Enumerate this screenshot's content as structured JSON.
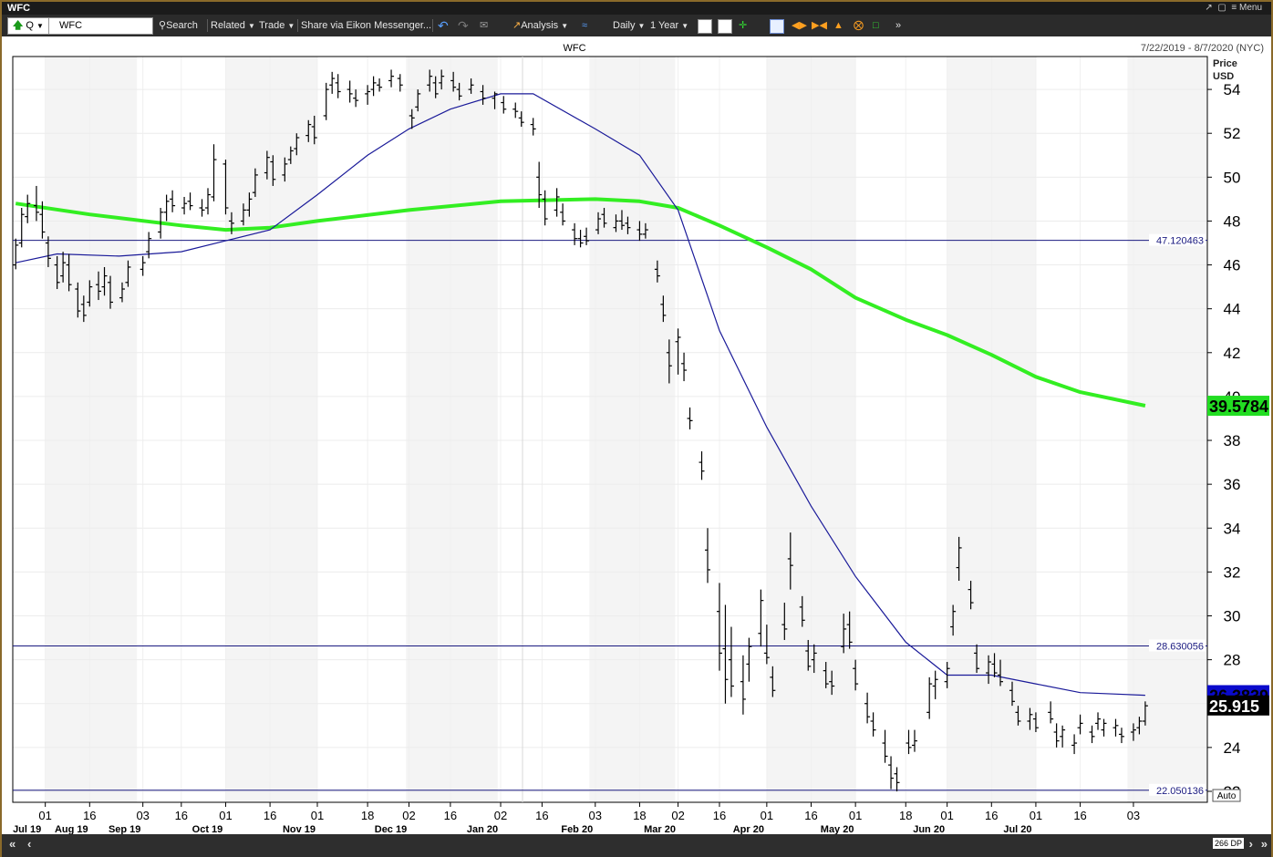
{
  "window": {
    "title": "WFC",
    "menu_label": "Menu"
  },
  "toolbar": {
    "ric_prefix": "Q",
    "ric_value": "WFC",
    "search_label": "Search",
    "related_label": "Related",
    "trade_label": "Trade",
    "share_label": "Share via Eikon Messenger...",
    "analysis_label": "Analysis",
    "interval_label": "Daily",
    "range_label": "1 Year"
  },
  "chart_header": {
    "symbol": "WFC",
    "date_range": "7/22/2019 - 8/7/2020 (NYC)",
    "price_axis_title_1": "Price",
    "price_axis_title_2": "USD"
  },
  "footer": {
    "datapoints": "266 DP",
    "auto_label": "Auto"
  },
  "colors": {
    "background": "#ffffff",
    "band_shade": "#f4f4f4",
    "ma200": "#33ee22",
    "ma50": "#1a1a99",
    "hline": "#1a1a80",
    "bars": "#000000",
    "last_price_bg": "#000000",
    "ma50_tag_bg": "#0a0acc",
    "ma200_tag_bg": "#22dd22"
  },
  "chart_data": {
    "type": "ohlc",
    "ylim": [
      21.5,
      55.5
    ],
    "y_ticks": [
      22,
      24,
      26,
      28,
      30,
      32,
      34,
      36,
      38,
      40,
      42,
      44,
      46,
      48,
      50,
      52,
      54
    ],
    "x_labels": [
      {
        "day": "01",
        "month": "Jul 19",
        "date": "2019-08-01"
      },
      {
        "day": "16",
        "month": "Aug 19",
        "date": "2019-08-16"
      },
      {
        "day": "03",
        "month": "Sep 19",
        "date": "2019-09-03"
      },
      {
        "day": "16",
        "date": "2019-09-16"
      },
      {
        "day": "01",
        "month": "Oct 19",
        "date": "2019-10-01"
      },
      {
        "day": "16",
        "date": "2019-10-16"
      },
      {
        "day": "01",
        "month": "Nov 19",
        "date": "2019-11-01"
      },
      {
        "day": "18",
        "date": "2019-11-18"
      },
      {
        "day": "02",
        "month": "Dec 19",
        "date": "2019-12-02"
      },
      {
        "day": "16",
        "date": "2019-12-16"
      },
      {
        "day": "02",
        "month": "Jan 20",
        "date": "2020-01-02"
      },
      {
        "day": "16",
        "date": "2020-01-16"
      },
      {
        "day": "03",
        "month": "Feb 20",
        "date": "2020-02-03"
      },
      {
        "day": "18",
        "date": "2020-02-18"
      },
      {
        "day": "02",
        "month": "Mar 20",
        "date": "2020-03-02"
      },
      {
        "day": "16",
        "date": "2020-03-16"
      },
      {
        "day": "01",
        "month": "Apr 20",
        "date": "2020-04-01"
      },
      {
        "day": "16",
        "date": "2020-04-16"
      },
      {
        "day": "01",
        "month": "May 20",
        "date": "2020-05-01"
      },
      {
        "day": "18",
        "date": "2020-05-18"
      },
      {
        "day": "01",
        "month": "Jun 20",
        "date": "2020-06-01"
      },
      {
        "day": "16",
        "date": "2020-06-16"
      },
      {
        "day": "01",
        "month": "Jul 20",
        "date": "2020-07-01"
      },
      {
        "day": "16",
        "date": "2020-07-16"
      },
      {
        "day": "03",
        "date": "2020-08-03"
      }
    ],
    "horizontal_lines": [
      {
        "label": "47.120463",
        "value": 47.120463
      },
      {
        "label": "28.630056",
        "value": 28.630056
      },
      {
        "label": "22.050136",
        "value": 22.050136
      }
    ],
    "last_price": {
      "label": "25.915",
      "value": 25.915
    },
    "ma50_last": {
      "label": "26.3839",
      "value": 26.3839
    },
    "ma200_last": {
      "label": "39.5784",
      "value": 39.5784
    },
    "ohlc": [
      [
        "2019-07-22",
        46.0,
        47.2,
        45.8,
        46.9
      ],
      [
        "2019-07-24",
        47.0,
        48.6,
        46.8,
        48.3
      ],
      [
        "2019-07-26",
        48.2,
        49.2,
        47.9,
        48.8
      ],
      [
        "2019-07-29",
        48.7,
        49.6,
        48.0,
        48.4
      ],
      [
        "2019-07-31",
        48.3,
        48.9,
        47.2,
        47.5
      ],
      [
        "2019-08-02",
        47.0,
        47.3,
        45.9,
        46.3
      ],
      [
        "2019-08-05",
        46.0,
        46.4,
        44.9,
        45.2
      ],
      [
        "2019-08-07",
        45.5,
        46.6,
        45.2,
        46.1
      ],
      [
        "2019-08-09",
        46.0,
        46.5,
        44.8,
        45.1
      ],
      [
        "2019-08-12",
        44.9,
        45.2,
        43.6,
        43.9
      ],
      [
        "2019-08-14",
        44.2,
        44.6,
        43.4,
        43.7
      ],
      [
        "2019-08-16",
        44.3,
        45.3,
        44.1,
        45.0
      ],
      [
        "2019-08-19",
        45.1,
        45.7,
        44.4,
        44.8
      ],
      [
        "2019-08-21",
        45.0,
        45.9,
        44.6,
        45.5
      ],
      [
        "2019-08-23",
        45.2,
        45.5,
        44.0,
        44.3
      ],
      [
        "2019-08-27",
        44.5,
        45.2,
        44.3,
        44.9
      ],
      [
        "2019-08-29",
        45.2,
        46.2,
        45.0,
        45.9
      ],
      [
        "2019-09-03",
        45.8,
        46.4,
        45.5,
        46.1
      ],
      [
        "2019-09-05",
        46.6,
        47.5,
        46.3,
        47.2
      ],
      [
        "2019-09-09",
        47.5,
        48.6,
        47.2,
        48.4
      ],
      [
        "2019-09-11",
        48.4,
        49.2,
        48.0,
        48.9
      ],
      [
        "2019-09-13",
        49.0,
        49.4,
        48.4,
        48.7
      ],
      [
        "2019-09-17",
        48.6,
        49.1,
        48.3,
        48.8
      ],
      [
        "2019-09-19",
        48.9,
        49.3,
        48.5,
        48.7
      ],
      [
        "2019-09-23",
        48.6,
        49.0,
        48.2,
        48.5
      ],
      [
        "2019-09-25",
        48.6,
        49.5,
        48.3,
        49.2
      ],
      [
        "2019-09-27",
        49.1,
        51.5,
        48.9,
        50.8
      ],
      [
        "2019-10-01",
        50.6,
        50.8,
        48.3,
        48.6
      ],
      [
        "2019-10-03",
        48.0,
        48.4,
        47.4,
        47.9
      ],
      [
        "2019-10-07",
        48.0,
        48.8,
        47.8,
        48.5
      ],
      [
        "2019-10-09",
        48.5,
        49.3,
        48.2,
        49.0
      ],
      [
        "2019-10-11",
        49.3,
        50.4,
        49.1,
        50.1
      ],
      [
        "2019-10-15",
        50.2,
        51.2,
        49.9,
        50.9
      ],
      [
        "2019-10-17",
        50.7,
        51.0,
        49.6,
        49.9
      ],
      [
        "2019-10-21",
        50.1,
        50.9,
        49.8,
        50.6
      ],
      [
        "2019-10-23",
        50.8,
        51.4,
        50.6,
        51.2
      ],
      [
        "2019-10-25",
        51.3,
        52.0,
        51.0,
        51.8
      ],
      [
        "2019-10-29",
        51.9,
        52.6,
        51.6,
        52.4
      ],
      [
        "2019-10-31",
        52.3,
        52.8,
        51.5,
        51.8
      ],
      [
        "2019-11-04",
        52.8,
        54.3,
        52.6,
        54.0
      ],
      [
        "2019-11-06",
        54.2,
        54.8,
        53.8,
        54.5
      ],
      [
        "2019-11-08",
        54.3,
        54.7,
        53.6,
        53.9
      ],
      [
        "2019-11-12",
        54.0,
        54.4,
        53.4,
        53.8
      ],
      [
        "2019-11-14",
        53.6,
        54.0,
        53.2,
        53.5
      ],
      [
        "2019-11-18",
        53.8,
        54.2,
        53.3,
        53.9
      ],
      [
        "2019-11-20",
        54.0,
        54.6,
        53.7,
        54.3
      ],
      [
        "2019-11-22",
        54.2,
        54.5,
        53.9,
        54.1
      ],
      [
        "2019-11-26",
        54.4,
        54.9,
        54.1,
        54.6
      ],
      [
        "2019-11-29",
        54.5,
        54.7,
        53.9,
        54.2
      ],
      [
        "2019-12-03",
        52.8,
        53.1,
        52.2,
        52.7
      ],
      [
        "2019-12-05",
        53.2,
        54.0,
        53.0,
        53.8
      ],
      [
        "2019-12-09",
        54.2,
        54.9,
        53.9,
        54.6
      ],
      [
        "2019-12-11",
        54.3,
        54.6,
        53.6,
        53.8
      ],
      [
        "2019-12-13",
        54.3,
        54.9,
        54.0,
        54.6
      ],
      [
        "2019-12-17",
        54.4,
        54.8,
        53.9,
        54.1
      ],
      [
        "2019-12-19",
        54.0,
        54.3,
        53.5,
        53.7
      ],
      [
        "2019-12-23",
        54.0,
        54.5,
        53.8,
        54.2
      ],
      [
        "2019-12-27",
        53.9,
        54.2,
        53.3,
        53.6
      ],
      [
        "2019-12-31",
        53.6,
        53.9,
        53.1,
        53.8
      ],
      [
        "2020-01-03",
        53.4,
        53.7,
        52.9,
        53.1
      ],
      [
        "2020-01-07",
        53.1,
        53.4,
        52.7,
        53.0
      ],
      [
        "2020-01-09",
        52.7,
        53.0,
        52.3,
        52.5
      ],
      [
        "2020-01-13",
        52.4,
        52.7,
        51.9,
        52.2
      ],
      [
        "2020-01-15",
        50.0,
        50.7,
        48.6,
        49.2
      ],
      [
        "2020-01-17",
        49.0,
        49.4,
        47.8,
        48.1
      ],
      [
        "2020-01-21",
        48.5,
        49.5,
        48.2,
        49.1
      ],
      [
        "2020-01-23",
        48.4,
        48.8,
        47.8,
        48.0
      ],
      [
        "2020-01-27",
        47.6,
        47.9,
        46.9,
        47.2
      ],
      [
        "2020-01-29",
        47.2,
        47.6,
        46.8,
        47.0
      ],
      [
        "2020-01-31",
        47.3,
        47.7,
        46.9,
        47.1
      ],
      [
        "2020-02-04",
        47.6,
        48.4,
        47.4,
        48.1
      ],
      [
        "2020-02-06",
        48.3,
        48.6,
        47.7,
        47.9
      ],
      [
        "2020-02-10",
        47.7,
        48.3,
        47.5,
        48.0
      ],
      [
        "2020-02-12",
        48.0,
        48.5,
        47.6,
        47.8
      ],
      [
        "2020-02-14",
        47.9,
        48.2,
        47.4,
        47.7
      ],
      [
        "2020-02-18",
        47.6,
        48.0,
        47.1,
        47.4
      ],
      [
        "2020-02-20",
        47.4,
        47.9,
        47.2,
        47.6
      ],
      [
        "2020-02-24",
        45.8,
        46.2,
        45.2,
        45.5
      ],
      [
        "2020-02-26",
        44.2,
        44.6,
        43.4,
        43.7
      ],
      [
        "2020-02-28",
        42.0,
        42.6,
        40.6,
        41.4
      ],
      [
        "2020-03-02",
        42.5,
        43.1,
        41.0,
        42.7
      ],
      [
        "2020-03-04",
        41.5,
        42.0,
        40.7,
        41.2
      ],
      [
        "2020-03-06",
        39.0,
        39.5,
        38.5,
        38.9
      ],
      [
        "2020-03-10",
        37.0,
        37.5,
        36.2,
        36.6
      ],
      [
        "2020-03-12",
        33.0,
        34.0,
        31.5,
        32.1
      ],
      [
        "2020-03-16",
        30.2,
        31.5,
        27.5,
        28.3
      ],
      [
        "2020-03-18",
        28.5,
        30.5,
        26.0,
        27.1
      ],
      [
        "2020-03-20",
        28.0,
        29.5,
        26.3,
        26.8
      ],
      [
        "2020-03-24",
        27.0,
        28.2,
        25.5,
        26.2
      ],
      [
        "2020-03-26",
        27.8,
        29.0,
        27.0,
        28.6
      ],
      [
        "2020-03-30",
        29.2,
        31.2,
        28.6,
        30.7
      ],
      [
        "2020-04-01",
        28.3,
        29.6,
        27.8,
        28.1
      ],
      [
        "2020-04-03",
        27.2,
        27.7,
        26.3,
        26.6
      ],
      [
        "2020-04-07",
        29.6,
        30.6,
        28.9,
        29.4
      ],
      [
        "2020-04-09",
        32.6,
        33.8,
        31.2,
        32.3
      ],
      [
        "2020-04-13",
        30.4,
        30.9,
        29.5,
        29.8
      ],
      [
        "2020-04-15",
        28.4,
        28.9,
        27.5,
        27.7
      ],
      [
        "2020-04-17",
        28.0,
        28.7,
        27.4,
        28.3
      ],
      [
        "2020-04-21",
        27.5,
        27.9,
        26.7,
        26.9
      ],
      [
        "2020-04-23",
        27.0,
        27.5,
        26.4,
        26.8
      ],
      [
        "2020-04-27",
        28.6,
        30.1,
        28.3,
        29.4
      ],
      [
        "2020-04-29",
        29.6,
        30.2,
        28.5,
        28.8
      ],
      [
        "2020-05-01",
        27.6,
        28.0,
        26.6,
        26.9
      ],
      [
        "2020-05-05",
        26.0,
        26.5,
        25.1,
        25.4
      ],
      [
        "2020-05-07",
        25.2,
        25.6,
        24.5,
        24.8
      ],
      [
        "2020-05-11",
        24.2,
        24.8,
        23.3,
        23.6
      ],
      [
        "2020-05-13",
        23.2,
        23.6,
        22.1,
        22.6
      ],
      [
        "2020-05-15",
        22.8,
        23.1,
        22.0,
        22.4
      ],
      [
        "2020-05-19",
        24.2,
        24.8,
        23.7,
        24.0
      ],
      [
        "2020-05-21",
        24.1,
        24.8,
        23.8,
        24.3
      ],
      [
        "2020-05-26",
        25.6,
        27.2,
        25.3,
        26.9
      ],
      [
        "2020-05-28",
        26.8,
        27.5,
        26.2,
        27.1
      ],
      [
        "2020-06-01",
        27.0,
        27.9,
        26.7,
        27.6
      ],
      [
        "2020-06-03",
        29.5,
        30.5,
        29.1,
        30.2
      ],
      [
        "2020-06-05",
        32.2,
        33.6,
        31.6,
        33.1
      ],
      [
        "2020-06-09",
        31.2,
        31.6,
        30.3,
        30.6
      ],
      [
        "2020-06-11",
        28.3,
        28.7,
        27.4,
        27.6
      ],
      [
        "2020-06-15",
        27.4,
        28.2,
        26.9,
        27.9
      ],
      [
        "2020-06-17",
        27.8,
        28.3,
        27.2,
        27.4
      ],
      [
        "2020-06-19",
        27.3,
        28.0,
        26.8,
        27.0
      ],
      [
        "2020-06-23",
        26.6,
        27.0,
        25.9,
        26.1
      ],
      [
        "2020-06-25",
        25.6,
        25.9,
        25.0,
        25.2
      ],
      [
        "2020-06-29",
        25.2,
        25.8,
        24.8,
        25.5
      ],
      [
        "2020-07-01",
        25.3,
        25.6,
        24.7,
        24.9
      ],
      [
        "2020-07-06",
        25.6,
        26.1,
        25.1,
        25.3
      ],
      [
        "2020-07-08",
        24.7,
        25.1,
        24.0,
        24.3
      ],
      [
        "2020-07-10",
        24.5,
        25.0,
        24.0,
        24.8
      ],
      [
        "2020-07-14",
        24.1,
        24.6,
        23.7,
        24.2
      ],
      [
        "2020-07-16",
        24.9,
        25.5,
        24.6,
        25.1
      ],
      [
        "2020-07-20",
        24.7,
        25.0,
        24.2,
        24.5
      ],
      [
        "2020-07-22",
        25.1,
        25.6,
        24.8,
        25.3
      ],
      [
        "2020-07-24",
        24.8,
        25.3,
        24.5,
        25.1
      ],
      [
        "2020-07-28",
        24.9,
        25.3,
        24.5,
        25.0
      ],
      [
        "2020-07-30",
        24.6,
        24.9,
        24.2,
        24.5
      ],
      [
        "2020-08-03",
        24.7,
        25.1,
        24.3,
        24.8
      ],
      [
        "2020-08-05",
        24.9,
        25.4,
        24.6,
        25.2
      ],
      [
        "2020-08-07",
        25.2,
        26.1,
        25.0,
        25.9
      ]
    ],
    "ma50": [
      [
        "2019-07-22",
        46.1
      ],
      [
        "2019-08-05",
        46.5
      ],
      [
        "2019-08-26",
        46.4
      ],
      [
        "2019-09-16",
        46.6
      ],
      [
        "2019-10-01",
        47.1
      ],
      [
        "2019-10-16",
        47.6
      ],
      [
        "2019-11-01",
        49.2
      ],
      [
        "2019-11-18",
        51.0
      ],
      [
        "2019-12-02",
        52.2
      ],
      [
        "2019-12-16",
        53.1
      ],
      [
        "2020-01-02",
        53.8
      ],
      [
        "2020-01-13",
        53.8
      ],
      [
        "2020-02-03",
        52.2
      ],
      [
        "2020-02-18",
        51.0
      ],
      [
        "2020-03-02",
        48.5
      ],
      [
        "2020-03-16",
        43.0
      ],
      [
        "2020-04-01",
        38.6
      ],
      [
        "2020-04-16",
        35.0
      ],
      [
        "2020-05-01",
        31.8
      ],
      [
        "2020-05-18",
        28.8
      ],
      [
        "2020-06-01",
        27.3
      ],
      [
        "2020-06-16",
        27.3
      ],
      [
        "2020-07-01",
        26.9
      ],
      [
        "2020-07-16",
        26.5
      ],
      [
        "2020-08-07",
        26.38
      ]
    ],
    "ma200": [
      [
        "2019-07-22",
        48.8
      ],
      [
        "2019-08-16",
        48.3
      ],
      [
        "2019-09-16",
        47.8
      ],
      [
        "2019-10-01",
        47.6
      ],
      [
        "2019-10-16",
        47.7
      ],
      [
        "2019-11-01",
        48.0
      ],
      [
        "2019-12-02",
        48.5
      ],
      [
        "2020-01-02",
        48.9
      ],
      [
        "2020-02-03",
        49.0
      ],
      [
        "2020-02-18",
        48.9
      ],
      [
        "2020-03-02",
        48.6
      ],
      [
        "2020-03-16",
        47.8
      ],
      [
        "2020-04-01",
        46.8
      ],
      [
        "2020-04-16",
        45.8
      ],
      [
        "2020-05-01",
        44.5
      ],
      [
        "2020-05-18",
        43.5
      ],
      [
        "2020-06-01",
        42.8
      ],
      [
        "2020-06-16",
        41.9
      ],
      [
        "2020-07-01",
        40.9
      ],
      [
        "2020-07-16",
        40.2
      ],
      [
        "2020-08-07",
        39.58
      ]
    ]
  }
}
